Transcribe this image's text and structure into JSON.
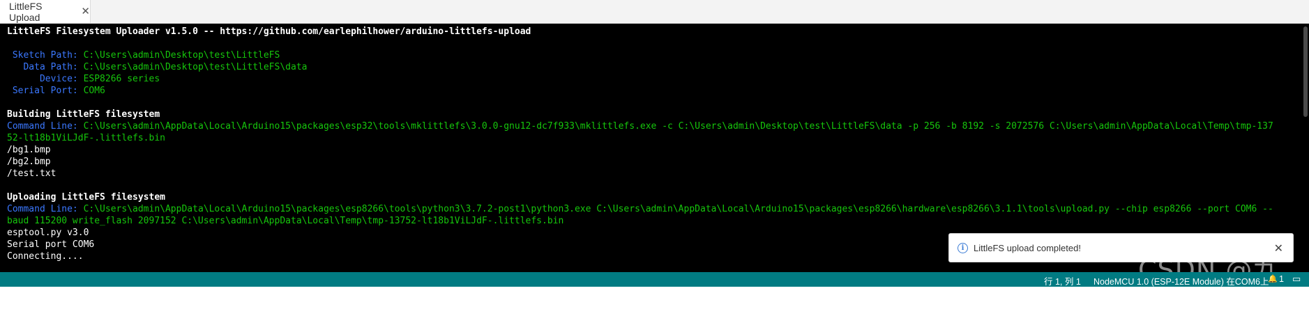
{
  "tab": {
    "label": "LittleFS Upload",
    "close": "✕"
  },
  "console": {
    "lines": [
      {
        "parts": [
          {
            "t": "LittleFS Filesystem Uploader v1.5.0 -- https://github.com/earlephilhower/arduino-littlefs-upload",
            "c": "#ffffff",
            "b": true
          }
        ]
      },
      {
        "parts": []
      },
      {
        "parts": [
          {
            "t": " Sketch Path: ",
            "c": "#3b78ff"
          },
          {
            "t": "C:\\Users\\admin\\Desktop\\test\\LittleFS",
            "c": "#16c60c"
          }
        ]
      },
      {
        "parts": [
          {
            "t": "   Data Path: ",
            "c": "#3b78ff"
          },
          {
            "t": "C:\\Users\\admin\\Desktop\\test\\LittleFS\\data",
            "c": "#16c60c"
          }
        ]
      },
      {
        "parts": [
          {
            "t": "      Device: ",
            "c": "#3b78ff"
          },
          {
            "t": "ESP8266 series",
            "c": "#16c60c"
          }
        ]
      },
      {
        "parts": [
          {
            "t": " Serial Port: ",
            "c": "#3b78ff"
          },
          {
            "t": "COM6",
            "c": "#16c60c"
          }
        ]
      },
      {
        "parts": []
      },
      {
        "parts": [
          {
            "t": "Building LittleFS filesystem",
            "c": "#ffffff",
            "b": true
          }
        ]
      },
      {
        "parts": [
          {
            "t": "Command Line: ",
            "c": "#3b78ff"
          },
          {
            "t": "C:\\Users\\admin\\AppData\\Local\\Arduino15\\packages\\esp32\\tools\\mklittlefs\\3.0.0-gnu12-dc7f933\\mklittlefs.exe -c C:\\Users\\admin\\Desktop\\test\\LittleFS\\data -p 256 -b 8192 -s 2072576 C:\\Users\\admin\\AppData\\Local\\Temp\\tmp-137",
            "c": "#16c60c"
          }
        ]
      },
      {
        "parts": [
          {
            "t": "52-lt18b1ViLJdF-.littlefs.bin",
            "c": "#16c60c"
          }
        ]
      },
      {
        "parts": [
          {
            "t": "/bg1.bmp",
            "c": "#ffffff"
          }
        ]
      },
      {
        "parts": [
          {
            "t": "/bg2.bmp",
            "c": "#ffffff"
          }
        ]
      },
      {
        "parts": [
          {
            "t": "/test.txt",
            "c": "#ffffff"
          }
        ]
      },
      {
        "parts": []
      },
      {
        "parts": [
          {
            "t": "Uploading LittleFS filesystem",
            "c": "#ffffff",
            "b": true
          }
        ]
      },
      {
        "parts": [
          {
            "t": "Command Line: ",
            "c": "#3b78ff"
          },
          {
            "t": "C:\\Users\\admin\\AppData\\Local\\Arduino15\\packages\\esp8266\\tools\\python3\\3.7.2-post1\\python3.exe C:\\Users\\admin\\AppData\\Local\\Arduino15\\packages\\esp8266\\hardware\\esp8266\\3.1.1\\tools\\upload.py --chip esp8266 --port COM6 --",
            "c": "#16c60c"
          }
        ]
      },
      {
        "parts": [
          {
            "t": "baud 115200 write_flash 2097152 C:\\Users\\admin\\AppData\\Local\\Temp\\tmp-13752-lt18b1ViLJdF-.littlefs.bin",
            "c": "#16c60c"
          }
        ]
      },
      {
        "parts": [
          {
            "t": "esptool.py v3.0",
            "c": "#ffffff"
          }
        ]
      },
      {
        "parts": [
          {
            "t": "Serial port COM6",
            "c": "#ffffff"
          }
        ]
      },
      {
        "parts": [
          {
            "t": "Connecting....",
            "c": "#ffffff"
          }
        ]
      }
    ]
  },
  "toast": {
    "icon": "info-icon",
    "icon_glyph": "i",
    "message": "LittleFS upload completed!",
    "close": "✕"
  },
  "watermark": {
    "text": "CSDN @九歌、"
  },
  "status": {
    "position": "行 1, 列 1",
    "board": "NodeMCU 1.0 (ESP-12E Module) 在COM6上",
    "notifications_count": "1",
    "bell_glyph": "🔔",
    "panel_glyph": "▭"
  },
  "colors": {
    "status_bg": "#017b82",
    "console_bg": "#000000",
    "label_blue": "#3b78ff",
    "value_green": "#16c60c"
  }
}
